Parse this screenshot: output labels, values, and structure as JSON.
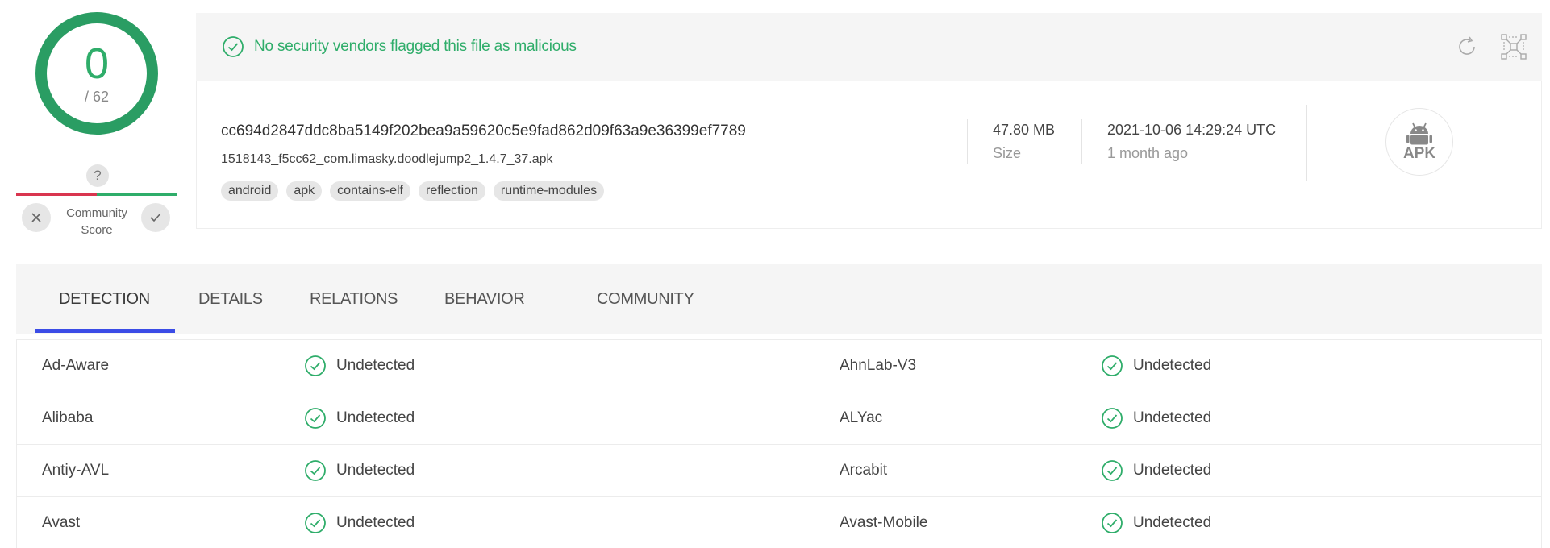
{
  "score": {
    "detections": "0",
    "total": "/ 62"
  },
  "community": {
    "question": "?",
    "label_line1": "Community",
    "label_line2": "Score"
  },
  "banner": {
    "message": "No security vendors flagged this file as malicious"
  },
  "file": {
    "hash": "cc694d2847ddc8ba5149f202bea9a59620c5e9fad862d09f63a9e36399ef7789",
    "name": "1518143_f5cc62_com.limasky.doodlejump2_1.4.7_37.apk",
    "tags": [
      "android",
      "apk",
      "contains-elf",
      "reflection",
      "runtime-modules"
    ],
    "size_value": "47.80 MB",
    "size_label": "Size",
    "date_value": "2021-10-06 14:29:24 UTC",
    "date_relative": "1 month ago",
    "type_badge": "APK"
  },
  "tabs": [
    {
      "label": "DETECTION"
    },
    {
      "label": "DETAILS"
    },
    {
      "label": "RELATIONS"
    },
    {
      "label": "BEHAVIOR"
    },
    {
      "label": "COMMUNITY"
    }
  ],
  "detections": [
    {
      "left_vendor": "Ad-Aware",
      "left_result": "Undetected",
      "right_vendor": "AhnLab-V3",
      "right_result": "Undetected"
    },
    {
      "left_vendor": "Alibaba",
      "left_result": "Undetected",
      "right_vendor": "ALYac",
      "right_result": "Undetected"
    },
    {
      "left_vendor": "Antiy-AVL",
      "left_result": "Undetected",
      "right_vendor": "Arcabit",
      "right_result": "Undetected"
    },
    {
      "left_vendor": "Avast",
      "left_result": "Undetected",
      "right_vendor": "Avast-Mobile",
      "right_result": "Undetected"
    }
  ],
  "colors": {
    "clean": "#2fad6a",
    "malicious": "#d9354f",
    "tab_accent": "#3b4ce6"
  },
  "icons": {
    "banner": "check-circle-icon",
    "reload": "reload-icon",
    "graph": "graph-icon",
    "vote_down": "close-icon",
    "vote_up": "check-icon",
    "file_type": "android-icon"
  }
}
